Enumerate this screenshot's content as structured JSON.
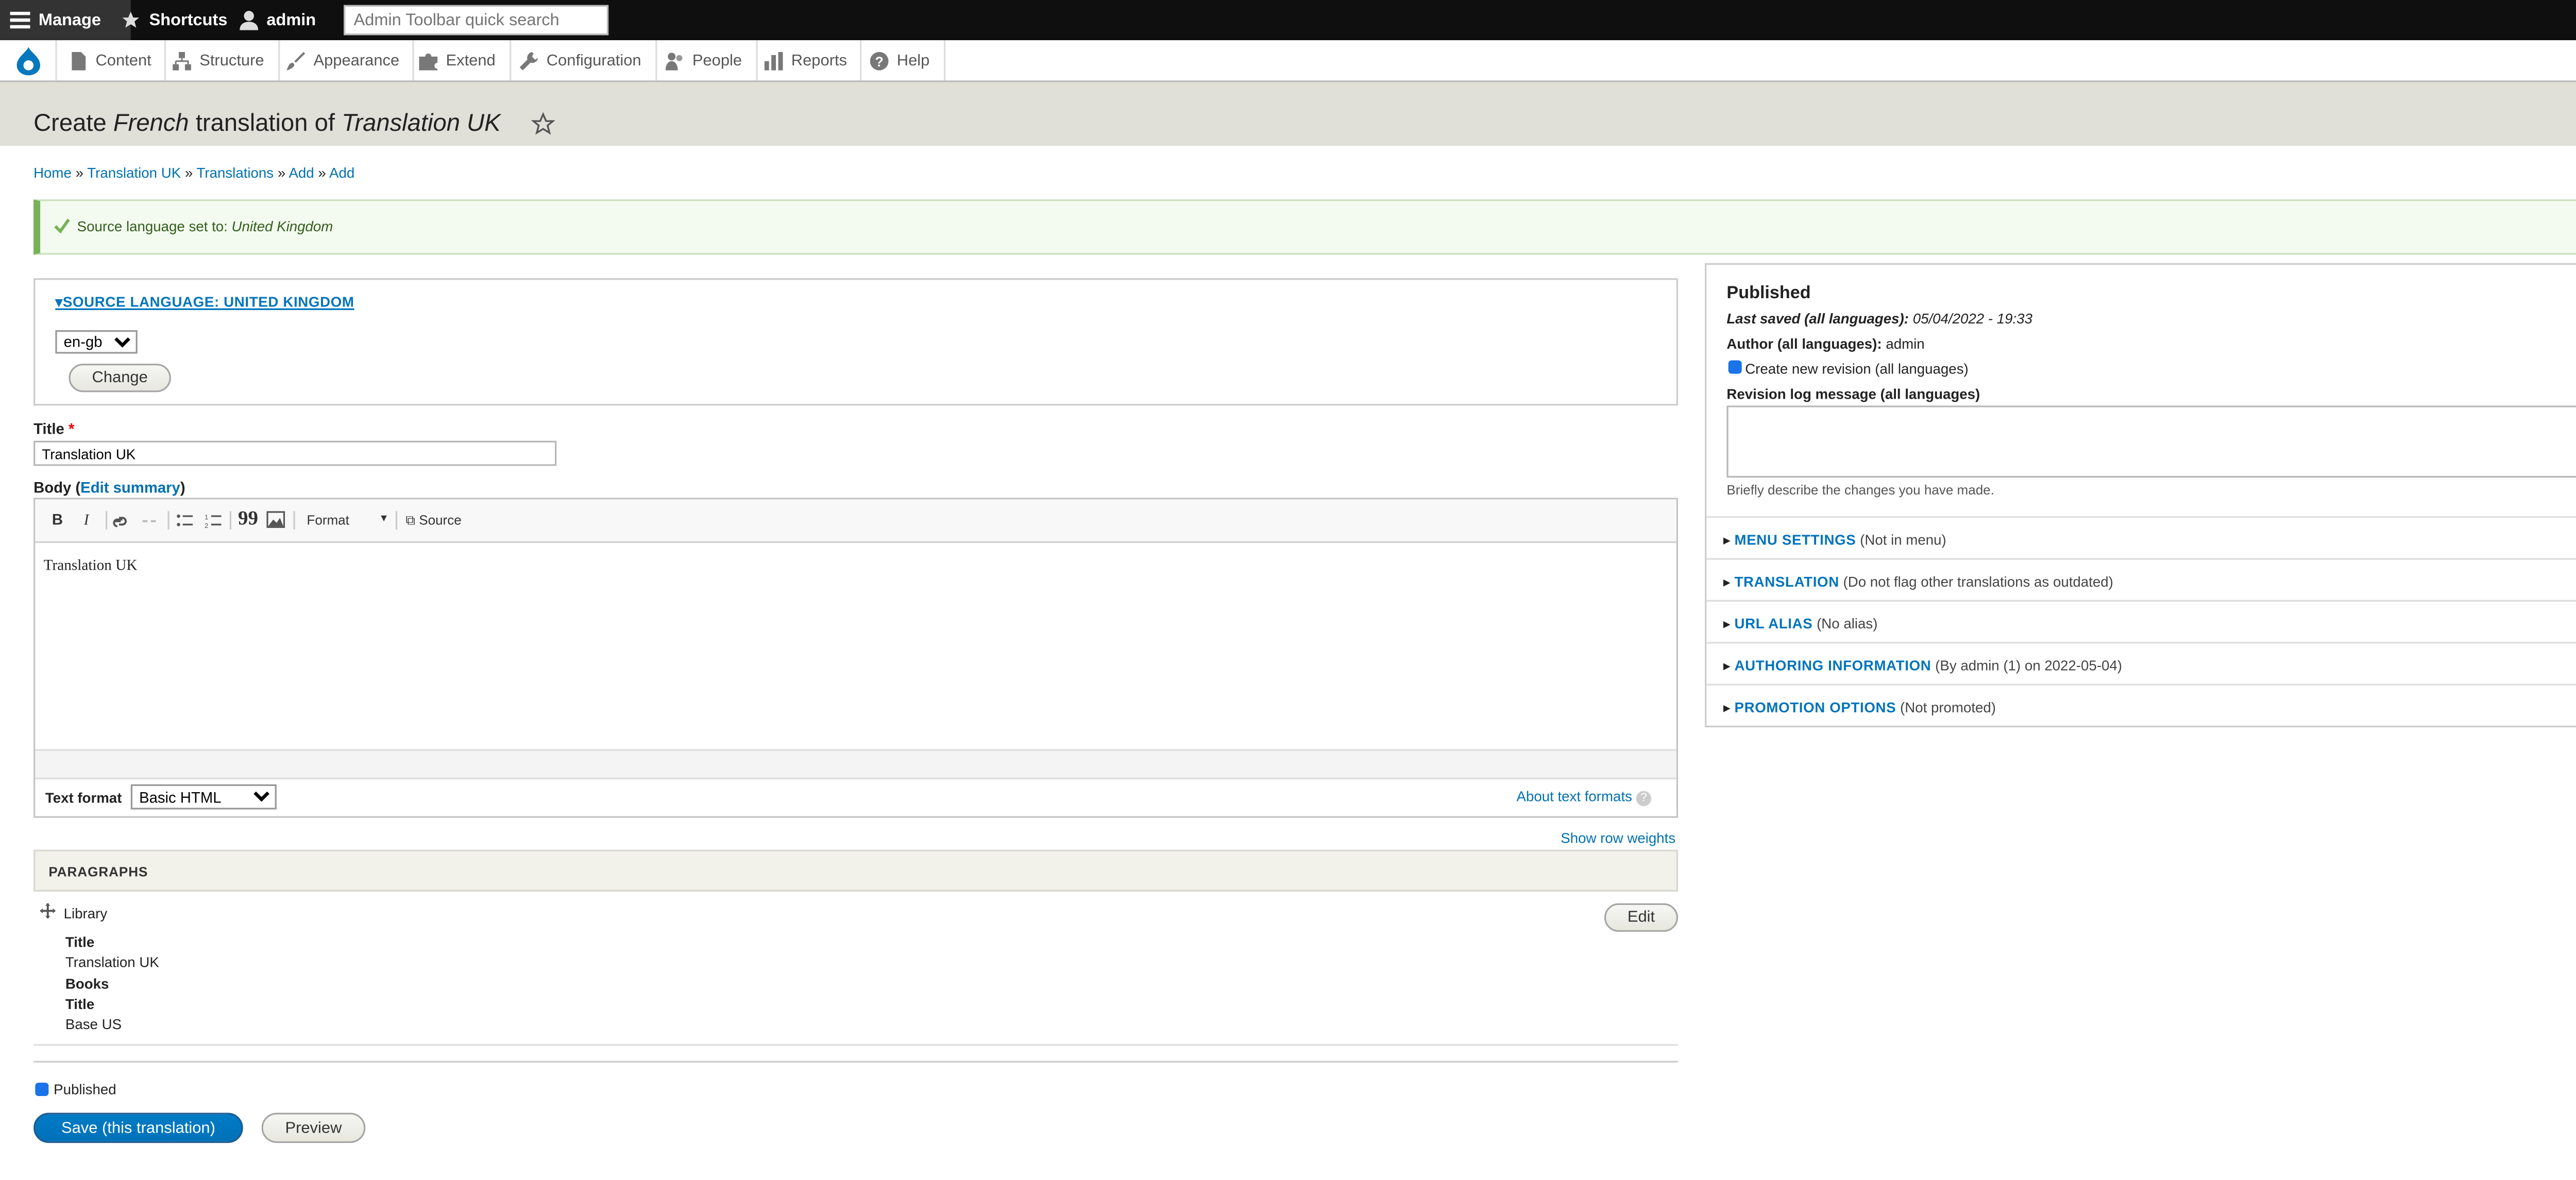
{
  "toolbar": {
    "manage": "Manage",
    "shortcuts": "Shortcuts",
    "user": "admin",
    "search_placeholder": "Admin Toolbar quick search"
  },
  "menu": {
    "content": "Content",
    "structure": "Structure",
    "appearance": "Appearance",
    "extend": "Extend",
    "configuration": "Configuration",
    "people": "People",
    "reports": "Reports",
    "help": "Help"
  },
  "page": {
    "title_prefix": "Create ",
    "title_lang": "French",
    "title_mid": " translation of ",
    "title_node": "Translation UK"
  },
  "breadcrumb": {
    "home": "Home",
    "node": "Translation UK",
    "translations": "Translations",
    "add1": "Add",
    "add2": "Add",
    "sep": "»"
  },
  "message": {
    "prefix": "Source language set to: ",
    "value": "United Kingdom"
  },
  "source_language": {
    "summary": "SOURCE LANGUAGE: UNITED KINGDOM",
    "selected": "en-gb",
    "change_button": "Change"
  },
  "form": {
    "title_label": "Title",
    "required_mark": "*",
    "title_value": "Translation UK",
    "body_label": "Body (",
    "edit_summary": "Edit summary",
    "body_label_end": ")",
    "editor_format_dropdown": "Format",
    "editor_source": "Source",
    "body_content": "Translation UK",
    "text_format_label": "Text format",
    "text_format_value": "Basic HTML",
    "about_formats": "About text formats",
    "show_row_weights": "Show row weights"
  },
  "paragraphs": {
    "header": "PARAGRAPHS",
    "item_type": "Library",
    "edit_button": "Edit",
    "lines": [
      {
        "text": "Title",
        "bold": true
      },
      {
        "text": "Translation UK",
        "bold": false
      },
      {
        "text": "Books",
        "bold": true
      },
      {
        "text": "Title",
        "bold": true
      },
      {
        "text": "Base US",
        "bold": false
      }
    ]
  },
  "footer": {
    "published_label": "Published",
    "save_button": "Save (this translation)",
    "preview_button": "Preview"
  },
  "sidebar": {
    "status": "Published",
    "last_saved_label": "Last saved (all languages):",
    "last_saved_value": "05/04/2022 - 19:33",
    "author_label": "Author (all languages):",
    "author_value": "admin",
    "new_revision": "Create new revision (all languages)",
    "revision_log_label": "Revision log message (all languages)",
    "revision_help": "Briefly describe the changes you have made.",
    "sections": [
      {
        "title": "MENU SETTINGS",
        "summary": "(Not in menu)"
      },
      {
        "title": "TRANSLATION",
        "summary": "(Do not flag other translations as outdated)"
      },
      {
        "title": "URL ALIAS",
        "summary": "(No alias)"
      },
      {
        "title": "AUTHORING INFORMATION",
        "summary": "(By admin (1) on 2022-05-04)"
      },
      {
        "title": "PROMOTION OPTIONS",
        "summary": "(Not promoted)"
      }
    ]
  },
  "colors": {
    "link": "#0071b3",
    "primary_button": "#0071b8",
    "status_green": "#77b259",
    "toolbar_bg": "#0f0f0f"
  }
}
